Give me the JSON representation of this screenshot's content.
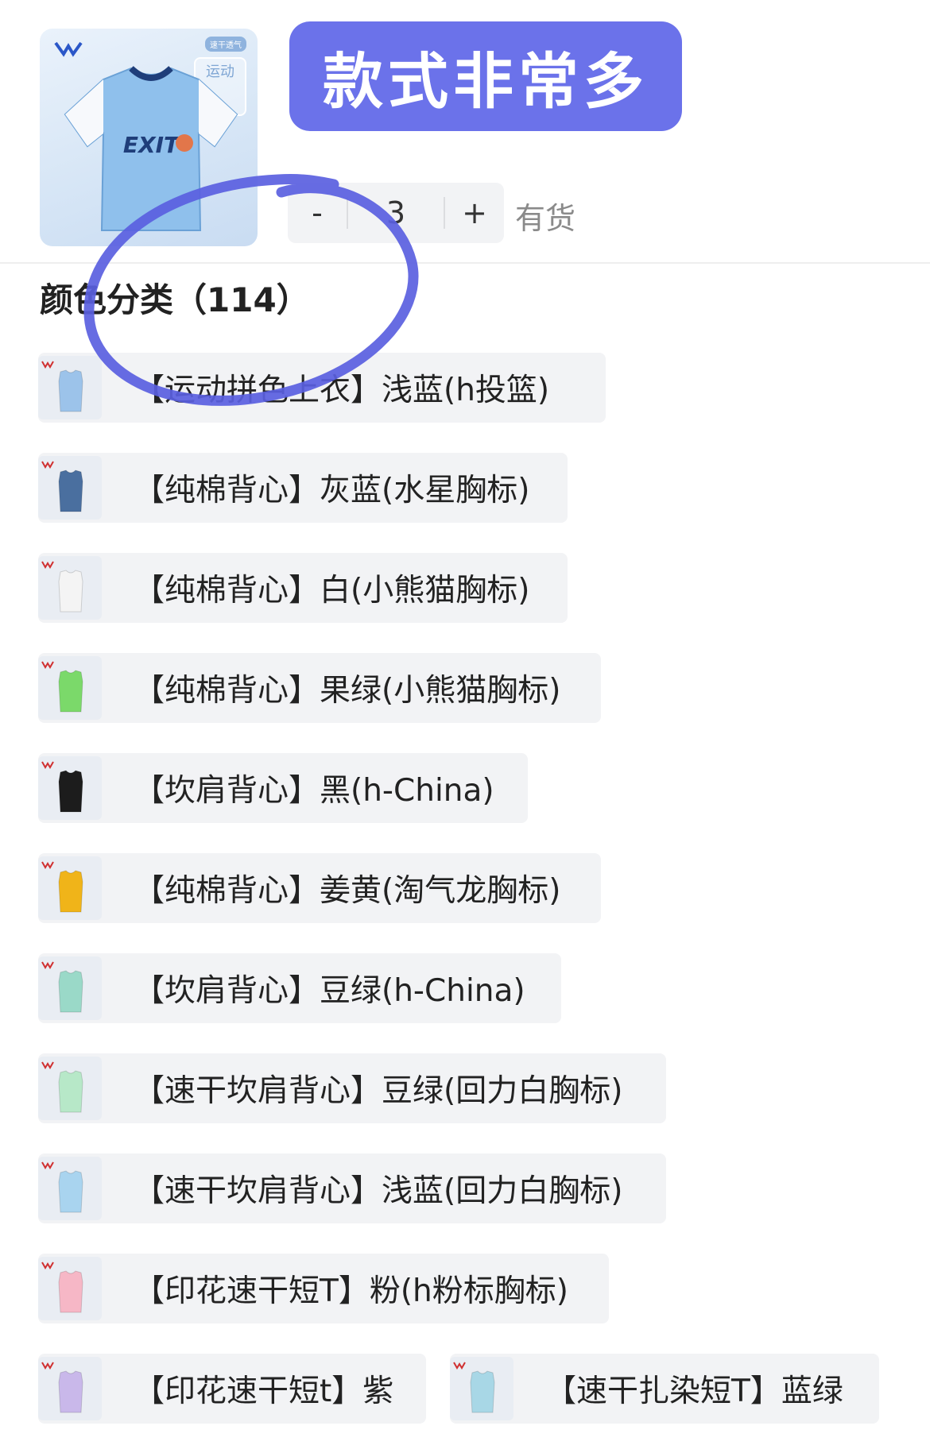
{
  "product": {
    "thumb_brand_icon": "warrior-logo-icon",
    "thumb_tag_top": "速干透气",
    "thumb_tag_sport": "运动",
    "thumb_shirt_text": "EXIT"
  },
  "banner": {
    "text": "款式非常多"
  },
  "quantity": {
    "minus": "-",
    "value": "3",
    "plus": "+",
    "stock": "有货"
  },
  "section": {
    "title": "颜色分类（114）"
  },
  "variants": [
    {
      "label": "【运动拼色上衣】浅蓝(h投篮)",
      "color": "#9cc3ea"
    },
    {
      "label": "【纯棉背心】灰蓝(水星胸标)",
      "color": "#4a6f9f"
    },
    {
      "label": "【纯棉背心】白(小熊猫胸标)",
      "color": "#f4f4f4"
    },
    {
      "label": "【纯棉背心】果绿(小熊猫胸标)",
      "color": "#7bd96a"
    },
    {
      "label": "【坎肩背心】黑(h-China)",
      "color": "#1c1c1c"
    },
    {
      "label": "【纯棉背心】姜黄(淘气龙胸标)",
      "color": "#f0b419"
    },
    {
      "label": "【坎肩背心】豆绿(h-China)",
      "color": "#9ad9c8"
    },
    {
      "label": "【速干坎肩背心】豆绿(回力白胸标)",
      "color": "#b7e8c8"
    },
    {
      "label": "【速干坎肩背心】浅蓝(回力白胸标)",
      "color": "#a9d4ef"
    },
    {
      "label": "【印花速干短T】粉(h粉标胸标)",
      "color": "#f6b7c6"
    },
    {
      "label": "【印花速干短t】紫",
      "color": "#c9b8ea"
    },
    {
      "label": "【速干扎染短T】蓝绿",
      "color": "#a8d7e6"
    }
  ],
  "colors": {
    "banner": "#6b72ea",
    "annotation": "#5a5fe0",
    "chip_bg": "#f2f3f5"
  }
}
